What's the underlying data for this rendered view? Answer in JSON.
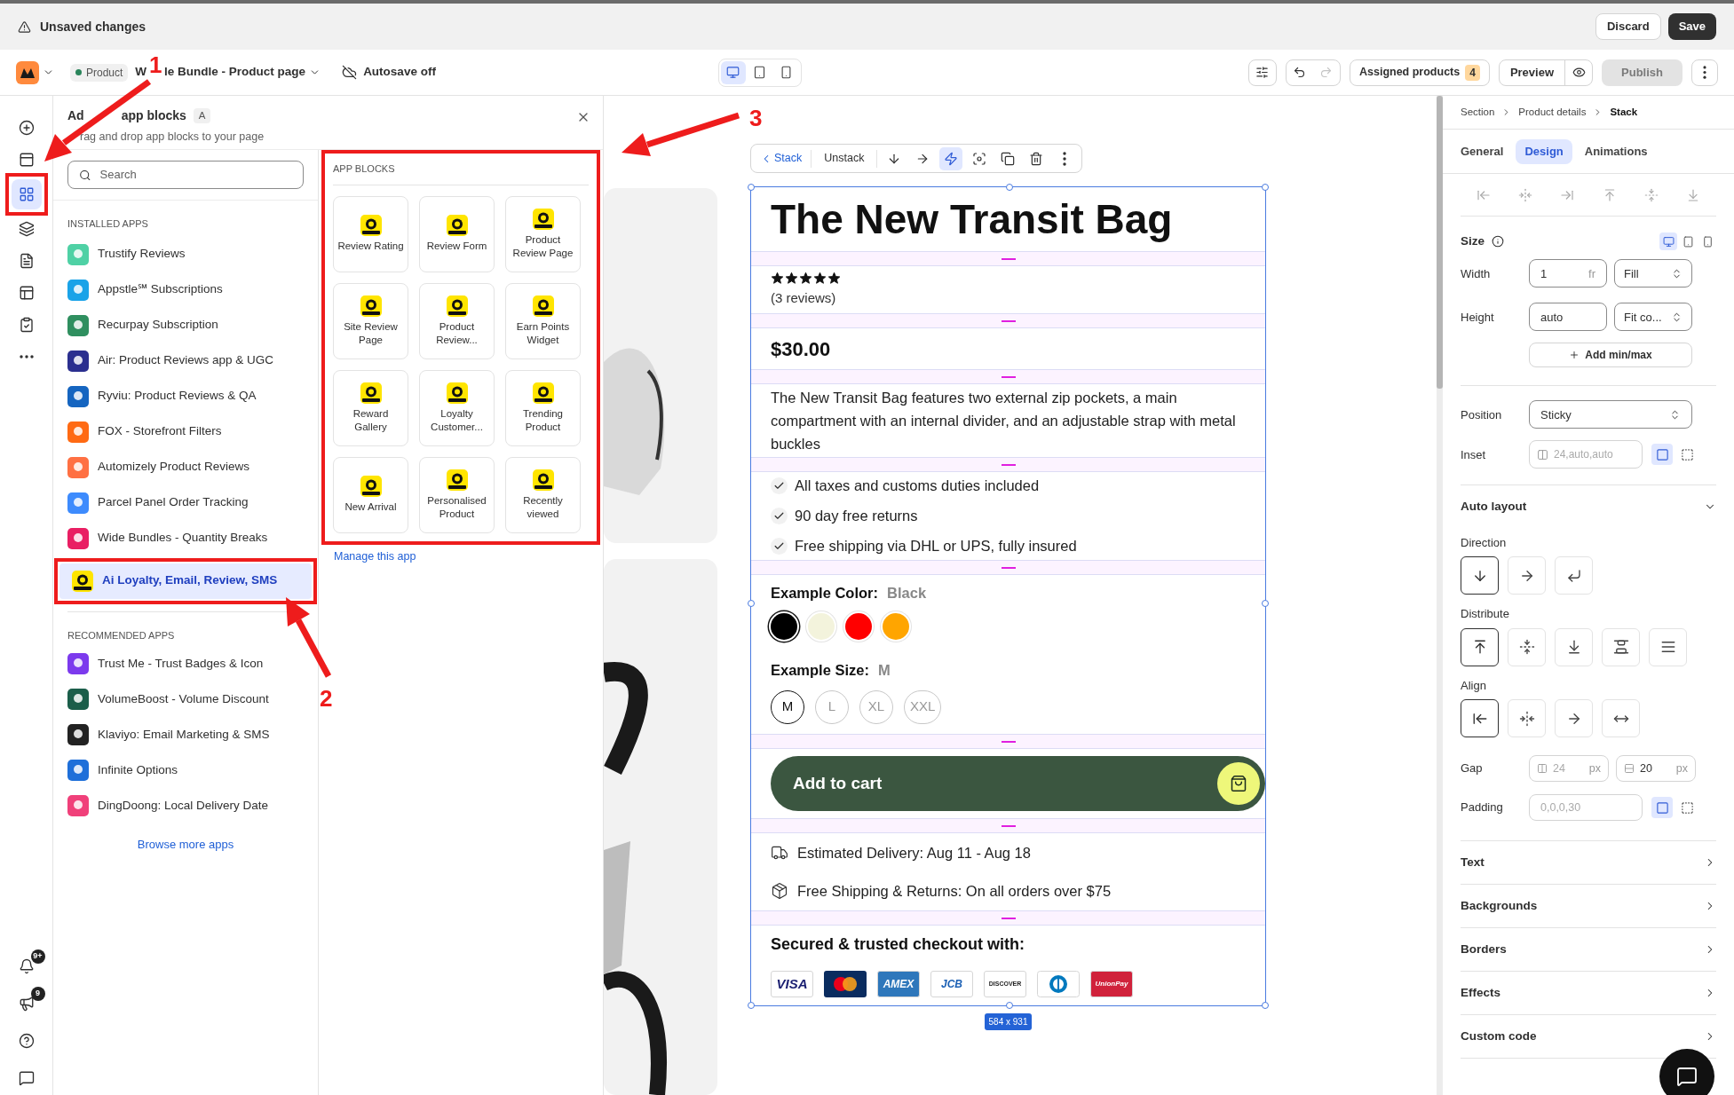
{
  "top_bar": {
    "title": "Unsaved changes",
    "buttons": [
      {
        "label": "Discard",
        "kind": "secondary"
      },
      {
        "label": "Save",
        "kind": "primary"
      }
    ]
  },
  "toolbar": {
    "status": "Product",
    "page_title_start": "W",
    "page_title": "le Bundle - Product page",
    "autosave": "Autosave off",
    "devices": [
      {
        "kind": "desktop",
        "selected": true
      },
      {
        "kind": "tablet",
        "selected": false
      },
      {
        "kind": "mobile",
        "selected": false
      }
    ],
    "assigned": {
      "label": "Assigned products",
      "count": "4"
    },
    "preview": "Preview",
    "publish": {
      "label": "Publish",
      "disabled": true
    }
  },
  "rail": {
    "items": [
      {
        "kind": "add",
        "selected": false,
        "highlighted": false
      },
      {
        "kind": "sections",
        "selected": false,
        "highlighted": false
      },
      {
        "kind": "apps",
        "selected": true,
        "highlighted": true
      },
      {
        "kind": "layers",
        "selected": false,
        "highlighted": false
      },
      {
        "kind": "pages",
        "selected": false,
        "highlighted": false
      },
      {
        "kind": "layout",
        "selected": false,
        "highlighted": false
      },
      {
        "kind": "checklist",
        "selected": false,
        "highlighted": false
      },
      {
        "kind": "more",
        "selected": false,
        "highlighted": false
      }
    ],
    "bottom": [
      {
        "kind": "bell",
        "badge": "9+"
      },
      {
        "kind": "megaphone",
        "badge": "9"
      },
      {
        "kind": "help"
      },
      {
        "kind": "chat"
      }
    ]
  },
  "panel": {
    "title_start": "Ad",
    "title": "app blocks",
    "shortcut": "A",
    "subtitle": "rag and drop app blocks to your page",
    "search": {
      "placeholder": "Search"
    },
    "installed_heading": "INSTALLED APPS",
    "installed": [
      {
        "name": "Trustify Reviews",
        "color": "#4fd1a5",
        "selected": false,
        "highlighted": false
      },
      {
        "name": "Appstle℠ Subscriptions",
        "color": "#1aa3e8",
        "selected": false,
        "highlighted": false
      },
      {
        "name": "Recurpay Subscription",
        "color": "#2f8f5f",
        "selected": false,
        "highlighted": false
      },
      {
        "name": "Air: Product Reviews app & UGC",
        "color": "#2b2f8f",
        "selected": false,
        "highlighted": false
      },
      {
        "name": "Ryviu: Product Reviews & QA",
        "color": "#1565c0",
        "selected": false,
        "highlighted": false
      },
      {
        "name": "FOX - Storefront Filters",
        "color": "#ff6a13",
        "selected": false,
        "highlighted": false
      },
      {
        "name": "Automizely Product Reviews",
        "color": "#ff7043",
        "selected": false,
        "highlighted": false
      },
      {
        "name": "Parcel Panel Order Tracking",
        "color": "#3d8bfd",
        "selected": false,
        "highlighted": false
      },
      {
        "name": "Wide Bundles - Quantity Breaks",
        "color": "#e91e63",
        "selected": false,
        "highlighted": false
      },
      {
        "name": "Ai Loyalty, Email, Review, SMS",
        "color": "#ffe500",
        "selected": true,
        "highlighted": true
      }
    ],
    "recommended_heading": "RECOMMENDED APPS",
    "recommended": [
      {
        "name": "Trust Me - Trust Badges & Icon",
        "color": "#7c3aed"
      },
      {
        "name": "VolumeBoost - Volume Discount",
        "color": "#1b5e4a"
      },
      {
        "name": "Klaviyo: Email Marketing & SMS",
        "color": "#222222"
      },
      {
        "name": "Infinite Options",
        "color": "#1e6fd9"
      },
      {
        "name": "DingDoong: Local Delivery Date",
        "color": "#f0407a"
      }
    ],
    "browse_more": "Browse more apps",
    "app_blocks": {
      "heading": "APP BLOCKS",
      "highlighted": true,
      "blocks": [
        "Review Rating",
        "Review Form",
        "Product Review Page",
        "Site Review Page",
        "Product Review...",
        "Earn Points Widget",
        "Reward Gallery",
        "Loyalty Customer...",
        "Trending Product",
        "New Arrival",
        "Personalised Product",
        "Recently viewed"
      ],
      "manage": "Manage this app"
    }
  },
  "canvas": {
    "toolbar": {
      "back": "Stack",
      "unstack": "Unstack",
      "tools": [
        {
          "kind": "down",
          "selected": false
        },
        {
          "kind": "right",
          "selected": false
        },
        {
          "kind": "bolt",
          "selected": true
        },
        {
          "kind": "focus",
          "selected": false
        },
        {
          "kind": "duplicate",
          "selected": false
        },
        {
          "kind": "delete",
          "selected": false
        },
        {
          "kind": "more",
          "selected": false
        }
      ]
    },
    "product": {
      "title": "The New Transit Bag",
      "stars": 5,
      "reviews": "(3 reviews)",
      "price": "$30.00",
      "description": "The New Transit Bag features two external zip pockets, a main compartment with an internal divider, and an adjustable strap with metal buckles",
      "features": [
        "All taxes and customs duties included",
        "90 day free returns",
        "Free shipping via DHL or UPS, fully insured"
      ],
      "color_label": "Example Color:",
      "color_value": "Black",
      "swatches": [
        {
          "color": "#000000",
          "selected": true
        },
        {
          "color": "#f3f3dc",
          "selected": false
        },
        {
          "color": "#ff0000",
          "selected": false
        },
        {
          "color": "#ffa500",
          "selected": false
        }
      ],
      "size_label": "Example Size:",
      "size_value": "M",
      "sizes": [
        {
          "label": "M",
          "selected": true
        },
        {
          "label": "L",
          "selected": false
        },
        {
          "label": "XL",
          "selected": false
        },
        {
          "label": "XXL",
          "selected": false
        }
      ],
      "add_to_cart": "Add to cart",
      "delivery": [
        {
          "kind": "truck",
          "text": "Estimated Delivery: Aug 11 - Aug 18"
        },
        {
          "kind": "package",
          "text": "Free Shipping & Returns: On all orders over $75"
        }
      ],
      "secure_title": "Secured & trusted checkout with:",
      "payments": [
        {
          "kind": "visa",
          "label": "VISA"
        },
        {
          "kind": "mastercard"
        },
        {
          "kind": "amex",
          "label": "AMEX"
        },
        {
          "kind": "jcb",
          "label": "JCB"
        },
        {
          "kind": "discover",
          "label": "DISCOVER"
        },
        {
          "kind": "diners"
        },
        {
          "kind": "unionpay",
          "label": "UnionPay"
        }
      ]
    },
    "size_tag": "584 x 931"
  },
  "inspector": {
    "breadcrumb": [
      "Section",
      "Product details",
      "Stack"
    ],
    "tabs": [
      {
        "label": "General",
        "selected": false
      },
      {
        "label": "Design",
        "selected": true
      },
      {
        "label": "Animations",
        "selected": false
      }
    ],
    "size": {
      "title": "Size",
      "devices": [
        {
          "kind": "desktop",
          "selected": true
        },
        {
          "kind": "tablet",
          "selected": false
        },
        {
          "kind": "mobile",
          "selected": false
        }
      ],
      "width": {
        "label": "Width",
        "value": "1",
        "unit": "fr",
        "mode": "Fill"
      },
      "height": {
        "label": "Height",
        "value": "auto",
        "mode": "Fit co..."
      },
      "add_minmax": "Add min/max"
    },
    "position": {
      "label": "Position",
      "value": "Sticky"
    },
    "inset": {
      "label": "Inset",
      "placeholder": "24,auto,auto",
      "modes": [
        {
          "kind": "all",
          "selected": true
        },
        {
          "kind": "individual",
          "selected": false
        }
      ]
    },
    "auto_layout": {
      "title": "Auto layout",
      "expanded": true,
      "direction": {
        "label": "Direction",
        "options": [
          {
            "kind": "down",
            "selected": true
          },
          {
            "kind": "right",
            "selected": false
          },
          {
            "kind": "wrap",
            "selected": false
          }
        ]
      },
      "distribute": {
        "label": "Distribute",
        "options": [
          {
            "kind": "top",
            "selected": true
          },
          {
            "kind": "center",
            "selected": false
          },
          {
            "kind": "bottom",
            "selected": false
          },
          {
            "kind": "between",
            "selected": false
          },
          {
            "kind": "around",
            "selected": false
          }
        ]
      },
      "align": {
        "label": "Align",
        "options": [
          {
            "kind": "left",
            "selected": true
          },
          {
            "kind": "center",
            "selected": false
          },
          {
            "kind": "right",
            "selected": false
          },
          {
            "kind": "stretch",
            "selected": false
          }
        ]
      },
      "gap": {
        "label": "Gap",
        "column": {
          "placeholder": "24",
          "unit": "px"
        },
        "row": {
          "value": "20",
          "unit": "px"
        }
      },
      "padding": {
        "label": "Padding",
        "placeholder": "0,0,0,30",
        "modes": [
          {
            "kind": "all",
            "selected": true
          },
          {
            "kind": "individual",
            "selected": false
          }
        ]
      }
    },
    "sections": [
      "Text",
      "Backgrounds",
      "Borders",
      "Effects",
      "Custom code"
    ]
  },
  "annotations": [
    {
      "label": "1"
    },
    {
      "label": "2"
    },
    {
      "label": "3"
    }
  ]
}
